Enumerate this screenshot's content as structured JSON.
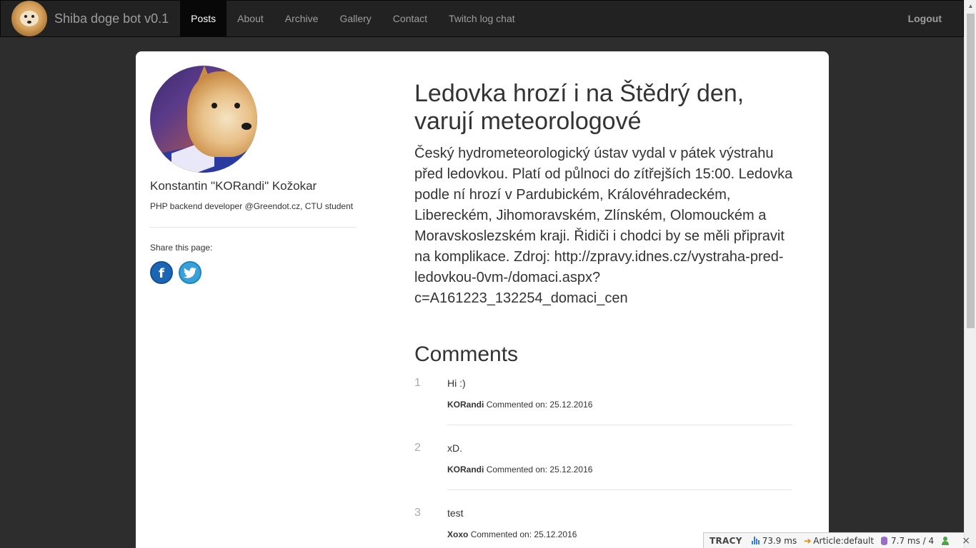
{
  "navbar": {
    "brand": "Shiba doge bot v0.1",
    "items": [
      {
        "label": "Posts",
        "active": true
      },
      {
        "label": "About",
        "active": false
      },
      {
        "label": "Archive",
        "active": false
      },
      {
        "label": "Gallery",
        "active": false
      },
      {
        "label": "Contact",
        "active": false
      },
      {
        "label": "Twitch log chat",
        "active": false
      }
    ],
    "logout": "Logout"
  },
  "sidebar": {
    "author_name": "Konstantin \"KORandi\" Kožokar",
    "author_bio": "PHP backend developer @Greendot.cz, CTU student",
    "share_label": "Share this page:",
    "social": [
      {
        "name": "facebook",
        "glyph": "f",
        "color": "#1a66b5"
      },
      {
        "name": "twitter",
        "color": "#3aa0d8"
      }
    ]
  },
  "article": {
    "title": "Ledovka hrozí i na Štědrý den, varují meteorologové",
    "body": "Český hydrometeorologický ústav vydal v pátek výstrahu před ledovkou. Platí od půlnoci do zítřejších 15:00. Ledovka podle ní hrozí v Pardubickém, Královéhradeckém, Libereckém, Jihomoravském, Zlínském, Olomouckém a Moravskoslezském kraji. Řidiči i chodci by se měli připravit na komplikace. Zdroj: http://zpravy.idnes.cz/vystraha-pred-ledovkou-0vm-/domaci.aspx?c=A161223_132254_domaci_cen"
  },
  "comments": {
    "heading": "Comments",
    "items": [
      {
        "num": "1",
        "text": "Hi :)",
        "author": "KORandi",
        "meta": "Commented on: 25.12.2016"
      },
      {
        "num": "2",
        "text": "xD.",
        "author": "KORandi",
        "meta": "Commented on: 25.12.2016"
      },
      {
        "num": "3",
        "text": "test",
        "author": "Xoxo",
        "meta": "Commented on: 25.12.2016"
      }
    ]
  },
  "tracy": {
    "logo": "TRACY",
    "time": "73.9 ms",
    "presenter": "Article:default",
    "db": "7.7 ms / 4",
    "close": "×"
  }
}
